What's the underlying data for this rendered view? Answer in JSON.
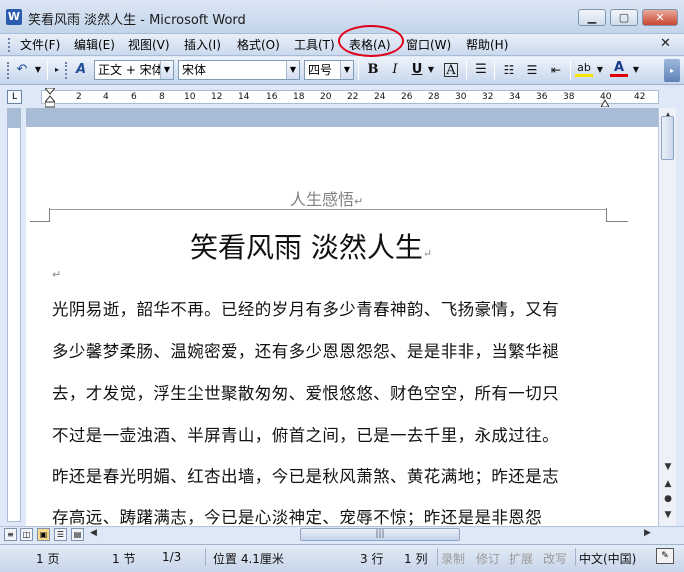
{
  "window": {
    "title": "笑看风雨 淡然人生 - Microsoft Word",
    "app_icon": "W"
  },
  "menu": {
    "items": [
      "文件(F)",
      "编辑(E)",
      "视图(V)",
      "插入(I)",
      "格式(O)",
      "工具(T)",
      "表格(A)",
      "窗口(W)",
      "帮助(H)"
    ],
    "highlighted": "表格(A)"
  },
  "toolbar": {
    "style": "正文 + 宋体",
    "font": "宋体",
    "size": "四号",
    "bold": "B",
    "italic": "I",
    "underline": "U",
    "char_border": "A",
    "font_color": "A",
    "highlight": "ab"
  },
  "ruler": {
    "corner": "L",
    "ticks": [
      "2",
      "4",
      "6",
      "8",
      "10",
      "12",
      "14",
      "16",
      "18",
      "20",
      "22",
      "24",
      "26",
      "28",
      "30",
      "32",
      "34",
      "36",
      "38",
      "40",
      "42"
    ]
  },
  "document": {
    "header": "人生感悟",
    "title": "笑看风雨  淡然人生",
    "lines": [
      "光阴易逝，韶华不再。已经的岁月有多少青春神韵、飞扬豪情，又有",
      "多少馨梦柔肠、温婉密爱，还有多少恩恩怨怨、是是非非，当繁华褪",
      "去，才发觉，浮生尘世聚散匆匆、爱恨悠悠、财色空空，所有一切只",
      "不过是一壶浊酒、半屏青山，俯首之间，已是一去千里，永成过往。",
      "昨还是春光明媚、红杏出墙，今已是秋风萧煞、黄花满地；昨还是志",
      "存高远、踌躇满志，今已是心淡神定、宠辱不惊；昨还是是非恩怨"
    ]
  },
  "statusbar": {
    "page": "1 页",
    "section": "1 节",
    "page_of": "1/3",
    "position": "位置 4.1厘米",
    "row": "3 行",
    "column": "1 列",
    "rec": "录制",
    "trk": "修订",
    "ext": "扩展",
    "ovr": "改写",
    "language": "中文(中国)"
  }
}
